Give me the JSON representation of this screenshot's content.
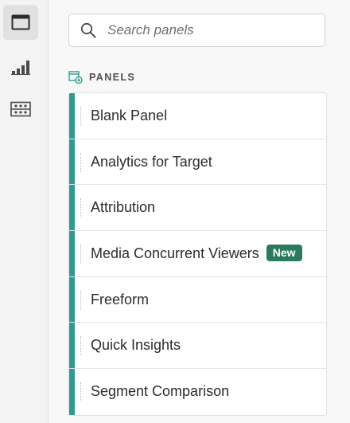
{
  "rail": {
    "items": [
      {
        "icon": "panel-window-icon",
        "active": true
      },
      {
        "icon": "bar-chart-icon",
        "active": false
      },
      {
        "icon": "components-icon",
        "active": false
      }
    ]
  },
  "search": {
    "placeholder": "Search panels",
    "value": ""
  },
  "section": {
    "icon": "panel-add-icon",
    "title": "PANELS"
  },
  "panels": [
    {
      "label": "Blank Panel",
      "badge": ""
    },
    {
      "label": "Analytics for Target",
      "badge": ""
    },
    {
      "label": "Attribution",
      "badge": ""
    },
    {
      "label": "Media Concurrent Viewers",
      "badge": "New"
    },
    {
      "label": "Freeform",
      "badge": ""
    },
    {
      "label": "Quick Insights",
      "badge": ""
    },
    {
      "label": "Segment Comparison",
      "badge": ""
    }
  ],
  "colors": {
    "accent": "#2d9d92",
    "badge": "#2a7a5c",
    "icon": "#4b4b4b",
    "section_icon": "#2d9d92"
  }
}
